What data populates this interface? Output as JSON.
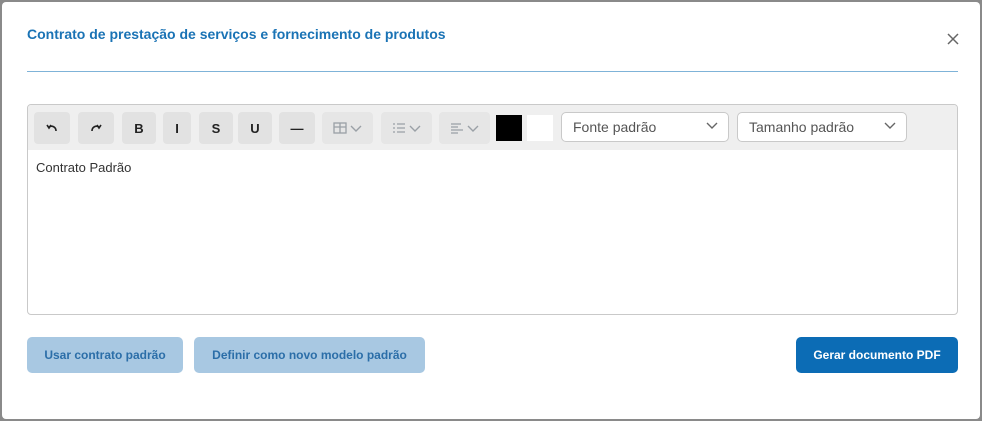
{
  "modal": {
    "title": "Contrato de prestação de serviços e fornecimento de produtos"
  },
  "toolbar": {
    "undo_icon": "undo-icon",
    "redo_icon": "redo-icon",
    "bold_label": "B",
    "italic_label": "I",
    "strike_label": "S",
    "underline_label": "U",
    "hr_label": "—",
    "table_icon": "table-icon",
    "list_icon": "list-icon",
    "align_icon": "align-left-icon",
    "text_color": "#000000",
    "bg_color": "#ffffff",
    "font_select": "Fonte padrão",
    "size_select": "Tamanho padrão"
  },
  "editor": {
    "content": "Contrato Padrão"
  },
  "actions": {
    "use_default": "Usar contrato padrão",
    "set_default": "Definir como novo modelo padrão",
    "generate_pdf": "Gerar documento PDF"
  },
  "colors": {
    "accent": "#0c6cb5",
    "title": "#1a73b5",
    "light_button": "#a8c8e2"
  }
}
